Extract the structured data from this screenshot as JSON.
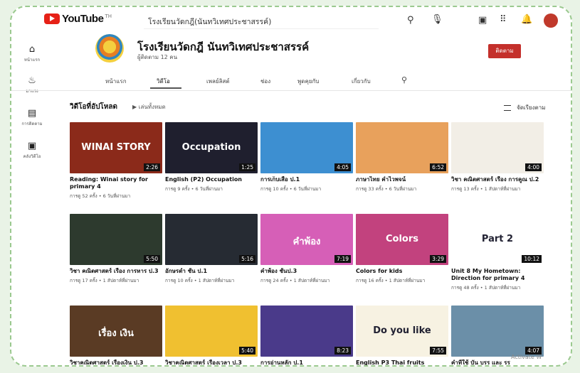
{
  "topbar": {
    "logo_text": "YouTube",
    "logo_suffix": "TH",
    "search_value": "โรงเรียนวัดกฎี(นันทวิเทศประชาสรรค์)"
  },
  "sidebar": {
    "items": [
      {
        "icon": "home-icon",
        "label": "หน้าแรก"
      },
      {
        "icon": "fire-icon",
        "label": "มาแรง"
      },
      {
        "icon": "subscriptions-icon",
        "label": "การติดตาม"
      },
      {
        "icon": "library-icon",
        "label": "คลังวิดีโอ"
      }
    ]
  },
  "channel": {
    "name": "โรงเรียนวัดกฎี นันทวิเทศประชาสรรค์",
    "subscribers": "ผู้ติดตาม 12 คน",
    "subscribe_label": "ติดตาม"
  },
  "tabs": [
    "หน้าแรก",
    "วิดีโอ",
    "เพลย์ลิสต์",
    "ช่อง",
    "พูดคุยกับ",
    "เกี่ยวกับ"
  ],
  "active_tab": "วิดีโอ",
  "section": {
    "title": "วิดีโอที่อัปโหลด",
    "play_all": "เล่นทั้งหมด",
    "sort_label": "จัดเรียงตาม"
  },
  "videos": [
    {
      "title": "Reading: Winai story for primary 4",
      "meta": "การดู 52 ครั้ง • 6 วันที่ผ่านมา",
      "duration": "2:26",
      "thumb_text": "WINAI STORY",
      "bg": "#8b2a1a"
    },
    {
      "title": "English (P2) Occupation",
      "meta": "การดู 9 ครั้ง • 6 วันที่ผ่านมา",
      "duration": "1:25",
      "thumb_text": "Occupation",
      "bg": "#1f1f2e"
    },
    {
      "title": "การเก็บเสื่อ ป.1",
      "meta": "การดู 10 ครั้ง • 6 วันที่ผ่านมา",
      "duration": "4:05",
      "thumb_text": "",
      "bg": "#3d8fd1"
    },
    {
      "title": "ภาษาไทย คำไวพจน์",
      "meta": "การดู 33 ครั้ง • 6 วันที่ผ่านมา",
      "duration": "6:52",
      "thumb_text": "",
      "bg": "#e8a15c"
    },
    {
      "title": "วิชา คณิตศาสตร์ เรื่อง การคูณ ป.2",
      "meta": "การดู 13 ครั้ง • 1 สัปดาห์ที่ผ่านมา",
      "duration": "4:00",
      "thumb_text": "",
      "bg": "#f2eee6"
    },
    {
      "title": "วิชา คณิตศาสตร์ เรื่อง การหาร ป.3",
      "meta": "การดู 17 ครั้ง • 1 สัปดาห์ที่ผ่านมา",
      "duration": "5:50",
      "thumb_text": "",
      "bg": "#2d3a2e"
    },
    {
      "title": "อักษรต่ำ ชั้น ป.1",
      "meta": "การดู 10 ครั้ง • 1 สัปดาห์ที่ผ่านมา",
      "duration": "5:16",
      "thumb_text": "",
      "bg": "#262b33"
    },
    {
      "title": "คำพ้อง ชั้นป.3",
      "meta": "การดู 24 ครั้ง • 1 สัปดาห์ที่ผ่านมา",
      "duration": "7:19",
      "thumb_text": "คำพ้อง",
      "bg": "#d65fb7"
    },
    {
      "title": "Colors for kids",
      "meta": "การดู 16 ครั้ง • 1 สัปดาห์ที่ผ่านมา",
      "duration": "3:29",
      "thumb_text": "Colors",
      "bg": "#c2427e"
    },
    {
      "title": "Unit 8 My Hometown: Direction for primary 4",
      "meta": "การดู 48 ครั้ง • 1 สัปดาห์ที่ผ่านมา",
      "duration": "10:12",
      "thumb_text": "Part 2",
      "bg": "#ffffff"
    },
    {
      "title": "วิชาคณิตศาสตร์ เรื่องเงิน ป.3",
      "meta": "",
      "duration": "",
      "thumb_text": "เรื่อง เงิน",
      "bg": "#5a3b24"
    },
    {
      "title": "วิชาคณิตศาสตร์ เรื่องเวลา ป.3",
      "meta": "",
      "duration": "5:40",
      "thumb_text": "",
      "bg": "#f0c030"
    },
    {
      "title": "การอ่านหลัก ป.1",
      "meta": "",
      "duration": "8:23",
      "thumb_text": "",
      "bg": "#4a3a8a"
    },
    {
      "title": "English P3 Thai fruits",
      "meta": "",
      "duration": "7:55",
      "thumb_text": "Do you like",
      "bg": "#f7f2e2"
    },
    {
      "title": "คำที่ใช้ บัน บรร และ รร",
      "meta": "",
      "duration": "4:07",
      "thumb_text": "",
      "bg": "#6b8fa8"
    }
  ],
  "watermark": "Activate W"
}
